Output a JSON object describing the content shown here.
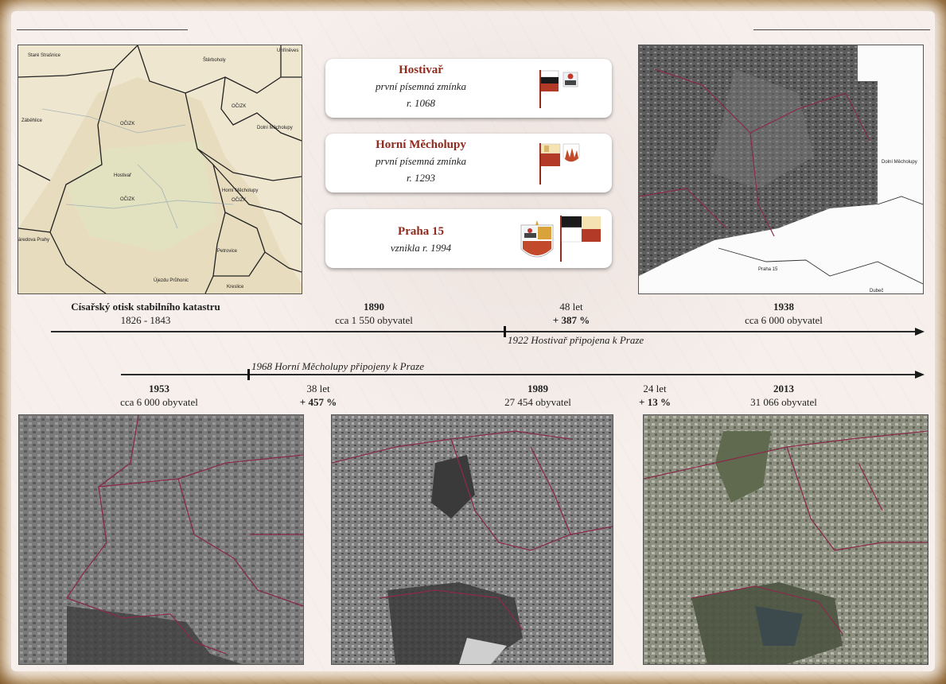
{
  "cards": [
    {
      "name": "Hostivař",
      "note": "první písemná zmínka",
      "year": "r. 1068"
    },
    {
      "name": "Horní Měcholupy",
      "note": "první písemná zmínka",
      "year": "r. 1293"
    },
    {
      "name": "Praha 15",
      "note": "vznikla r. 1994",
      "year": ""
    }
  ],
  "timeline_top": {
    "cadastre_title": "Císařský otisk stabilního katastru",
    "cadastre_years": "1826 - 1843",
    "y1890": "1890",
    "pop1890": "cca 1 550 obyvatel",
    "gap1_years": "48 let",
    "gap1_change": "+ 387 %",
    "y1938": "1938",
    "pop1938": "cca 6 000 obyvatel",
    "event1922": "1922 Hostivař připojena k Praze"
  },
  "timeline_bottom": {
    "event1968": "1968 Horní Měcholupy připojeny k Praze",
    "y1953": "1953",
    "pop1953": "cca 6 000 obyvatel",
    "gap2_years": "38 let",
    "gap2_change": "+ 457 %",
    "y1989": "1989",
    "pop1989": "27 454 obyvatel",
    "gap3_years": "24 let",
    "gap3_change": "+ 13 %",
    "y2013": "2013",
    "pop2013": "31 066 obyvatel"
  },
  "cadastre_map_labels": {
    "a": "Staré Strašnice",
    "b": "Štěrboholy",
    "c": "Záběhlice",
    "d": "Hostivař",
    "e": "Dolní Měcholupy",
    "f": "Horní Měcholupy",
    "g": "Petrovice",
    "h": "Kreslice",
    "i": "Újezdu Průhonic",
    "j": "áredova Prahy",
    "k": "Uhříněves",
    "l": "OČIZK",
    "m": "OČIZK",
    "n": "OČIZK",
    "o": "OČIZK"
  },
  "map1938_labels": {
    "a": "Dolní Měcholupy",
    "b": "Praha 15",
    "c": "Dubeč"
  },
  "colors": {
    "card_title": "#8f2a1c",
    "boundary": "#8a2a4a",
    "cadastre_bg": "#efe6cf"
  },
  "icons": [
    "hostivar-flag-icon",
    "hostivar-coat-icon",
    "mecholupy-flag-icon",
    "mecholupy-coat-icon",
    "praha15-coat-icon",
    "praha15-flag-icon"
  ]
}
